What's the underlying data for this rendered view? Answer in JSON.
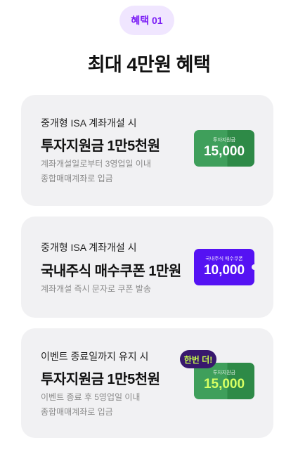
{
  "pill": {
    "label": "혜택 01"
  },
  "heading": "최대 4만원 혜택",
  "cards": [
    {
      "condition": "중개형 ISA 계좌개설 시",
      "title": "투자지원금 1만5천원",
      "desc_lines": [
        "계좌개설일로부터 3영업일 이내",
        "종합매매계좌로 입금"
      ],
      "ticket": {
        "label": "투자지원금",
        "value": "15,000",
        "color": "#3f9f5b"
      }
    },
    {
      "condition": "중개형 ISA 계좌개설 시",
      "title": "국내주식 매수쿠폰 1만원",
      "desc_lines": [
        "계좌개설 즉시 문자로 쿠폰 발송"
      ],
      "ticket": {
        "label": "국내주식 매수쿠폰",
        "value": "10,000",
        "color": "#5512f3"
      }
    },
    {
      "condition": "이벤트 종료일까지 유지 시",
      "title": "투자지원금 1만5천원",
      "desc_lines": [
        "이벤트 종료 후 5영업일 이내",
        "종합매매계좌로 입금"
      ],
      "badge": "한번 더!",
      "ticket": {
        "label": "투자지원금",
        "value": "15,000",
        "color": "#3f9f5b",
        "value_color": "#d7ff63"
      }
    }
  ]
}
